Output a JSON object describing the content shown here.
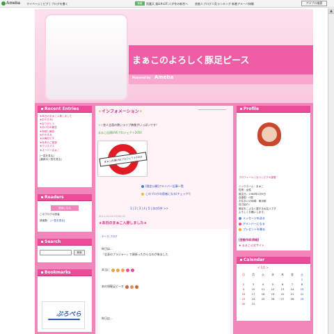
{
  "topbar": {
    "logo": "Ameba",
    "nav": "マイページ | ピグ | ブログを書く",
    "news_badge": "新着",
    "news": "雨蓋天 風&#x2F;人が冬の新作へ",
    "news2": "芸能人ブログ人気ランキング 新着アメーバ体験",
    "search_label": "アメブロ検索"
  },
  "header": {
    "title": "まぁこのよろしく豚足ピース",
    "powered": "Powered by",
    "powered_brand": "Ameba"
  },
  "left": {
    "recent_title": "Recent Entries",
    "recent_items": [
      "★本日のまぁこ入荷しました",
      "★おやすみ♪",
      "★ありがとう",
      "★あけおめ報告",
      "★年越し報告",
      "★おやすみ",
      "★大晦日です",
      "★年末のご挨拶",
      "★クリスマス",
      "★スーパーまぁこ"
    ],
    "recent_more": "[一覧を見る]",
    "recent_more2": "[最新の一覧を見る]",
    "readers_title": "Readers",
    "readers_btn": "読者になる",
    "readers_text": "このブログの読者",
    "readers_text2": "読者数：",
    "readers_more": "[一覧を見る]",
    "search_title": "Search",
    "search_btn": "検索",
    "bookmarks_title": "Bookmarks",
    "bookmark_brand": "ぷろぺら"
  },
  "center": {
    "info_title": "インフォメーション",
    "info_text": "☆☆芸人企画の熱いライブ映像がいっぱいです！",
    "info_link": "まぁこ出演LIVEプロジェクト2010",
    "banner_text": "まぁこ出演LIVEプロジェクト2010",
    "link1": "[限定公開]アメンバー記事一覧",
    "link2": "このブログの読者になる(チェック!)",
    "pager": "1 | 2 | 3 | 4 | 5 | 次の5件 >>",
    "post_date": "2011-01-04 23:59:31",
    "post_title": "★本日のまぁこ入荷しました★",
    "theme": "テーマ:ブログ",
    "lines": [
      "昨日は…",
      "『全身のブラジャー』で頑張ったからなのが来ました",
      "本当に",
      "あの頃豚足ピース",
      "昨日は…"
    ]
  },
  "right": {
    "profile_title": "Profile",
    "prof_links": "プロフィール | なう | ピグの部屋",
    "prof_text": [
      "ニックネーム：まぁこ",
      "性別：女性",
      "誕生日：1986年2月5日",
      "血液型：O型",
      "お住まいの地域：東京都",
      "自己紹介：",
      "豚足をこよなく愛する女芸人です",
      "よろしくお願いします。"
    ],
    "actions": [
      "メッセージを送る",
      "アメンバーになる",
      "プレゼントを贈る"
    ],
    "special": "[芸能作成:詳細]",
    "special2": "★ まぁこ公式サイト",
    "calendar_title": "Calendar",
    "calendar_head": "< 1月 >",
    "calendar_days": [
      "日",
      "月",
      "火",
      "水",
      "木",
      "金",
      "土"
    ],
    "calendar_rows": [
      [
        "",
        "",
        "",
        "",
        "",
        "",
        "1"
      ],
      [
        "2",
        "3",
        "4",
        "5",
        "6",
        "7",
        "8"
      ],
      [
        "9",
        "10",
        "11",
        "12",
        "13",
        "14",
        "15"
      ],
      [
        "16",
        "17",
        "18",
        "19",
        "20",
        "21",
        "22"
      ],
      [
        "23",
        "24",
        "25",
        "26",
        "27",
        "28",
        "29"
      ],
      [
        "30",
        "31",
        "",
        "",
        "",
        "",
        ""
      ]
    ]
  },
  "colors": {
    "pink_main": "#ea4c97",
    "pink_frame": "#f285ba"
  }
}
